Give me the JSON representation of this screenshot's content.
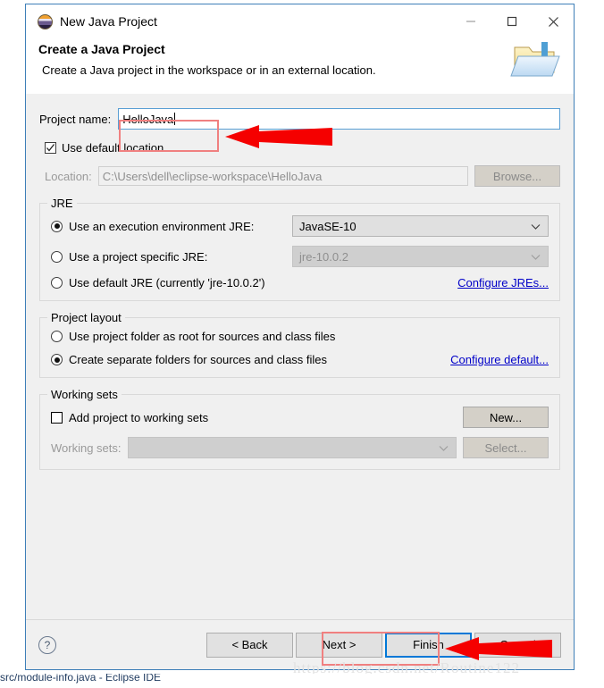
{
  "window": {
    "title": "New Java Project",
    "icon": "java-logo-icon",
    "controls": {
      "minimize": "minimize-icon",
      "maximize": "maximize-icon",
      "close": "close-icon"
    }
  },
  "header": {
    "title": "Create a Java Project",
    "description": "Create a Java project in the workspace or in an external location.",
    "icon": "new-java-project-folder-icon"
  },
  "form": {
    "project_name_label": "Project name:",
    "project_name_value": "HelloJava",
    "use_default_location_label": "Use default location",
    "use_default_location_checked": true,
    "location_label": "Location:",
    "location_value": "C:\\Users\\dell\\eclipse-workspace\\HelloJava",
    "browse_button": "Browse..."
  },
  "jre": {
    "group_title": "JRE",
    "options": [
      {
        "label": "Use an execution environment JRE:",
        "selected": true,
        "combo_value": "JavaSE-10",
        "combo_disabled": false
      },
      {
        "label": "Use a project specific JRE:",
        "selected": false,
        "combo_value": "jre-10.0.2",
        "combo_disabled": true
      },
      {
        "label": "Use default JRE (currently 'jre-10.0.2')",
        "selected": false
      }
    ],
    "configure_link": "Configure JREs..."
  },
  "project_layout": {
    "group_title": "Project layout",
    "options": [
      {
        "label": "Use project folder as root for sources and class files",
        "selected": false
      },
      {
        "label": "Create separate folders for sources and class files",
        "selected": true
      }
    ],
    "configure_link": "Configure default..."
  },
  "working_sets": {
    "group_title": "Working sets",
    "add_checkbox_label": "Add project to working sets",
    "add_checkbox_checked": false,
    "new_button": "New...",
    "working_sets_label": "Working sets:",
    "working_sets_value": "",
    "select_button": "Select..."
  },
  "buttonbar": {
    "help_icon": "help-question-icon",
    "back_button": "< Back",
    "next_button": "Next >",
    "finish_button": "Finish",
    "cancel_button": "Cancel"
  },
  "annotations": {
    "watermark": "https://blog.csdn.net/Routine122",
    "taskbar_text": "src/module-info.java - Eclipse IDE",
    "highlight_color": "#f08080",
    "arrow_color": "#f50000"
  }
}
